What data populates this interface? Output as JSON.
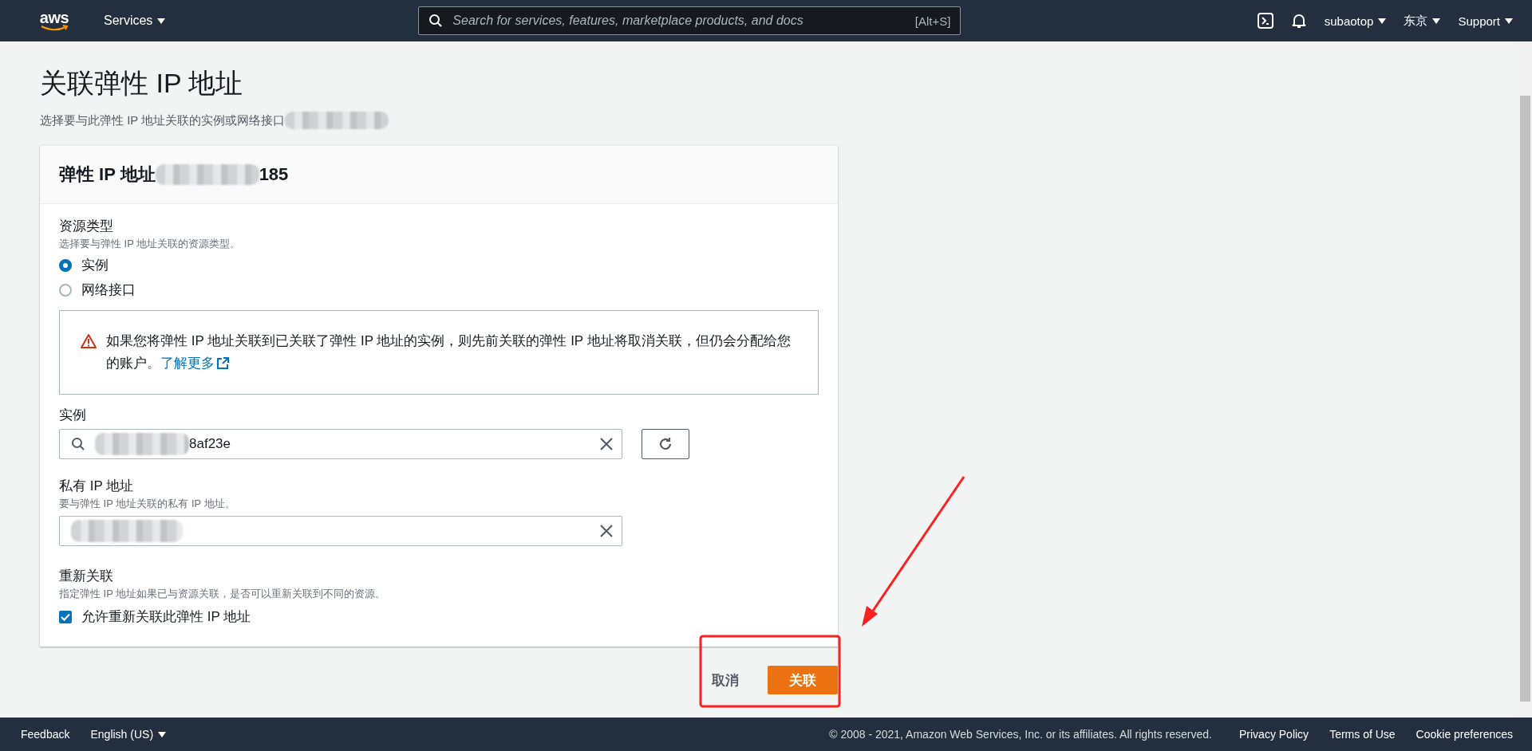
{
  "top_nav": {
    "logo": "aws",
    "services": "Services",
    "search": {
      "placeholder": "Search for services, features, marketplace products, and docs",
      "shortcut": "[Alt+S]"
    },
    "menus": [
      {
        "label": "subaotop"
      },
      {
        "label": "东京"
      },
      {
        "label": "Support"
      }
    ]
  },
  "page": {
    "title": "关联弹性 IP 地址",
    "subtitle": "选择要与此弹性 IP 地址关联的实例或网络接口"
  },
  "card": {
    "header_prefix": "弹性 IP 地址",
    "header_suffix": "185",
    "resource_type": {
      "label": "资源类型",
      "description": "选择要与弹性 IP 地址关联的资源类型。",
      "options": [
        {
          "label": "实例",
          "selected": true
        },
        {
          "label": "网络接口",
          "selected": false
        }
      ]
    },
    "warning": {
      "text": "如果您将弹性 IP 地址关联到已关联了弹性 IP 地址的实例，则先前关联的弹性 IP 地址将取消关联，但仍会分配给您的账户。",
      "link": "了解更多"
    },
    "instance": {
      "label": "实例",
      "value": "8af23e"
    },
    "private_ip": {
      "label": "私有 IP 地址",
      "description": "要与弹性 IP 地址关联的私有 IP 地址。"
    },
    "reassociation": {
      "label": "重新关联",
      "description": "指定弹性 IP 地址如果已与资源关联，是否可以重新关联到不同的资源。",
      "checkbox": {
        "label": "允许重新关联此弹性 IP 地址",
        "checked": true
      }
    }
  },
  "actions": {
    "cancel": "取消",
    "submit": "关联"
  },
  "footer": {
    "left": [
      {
        "label": "Feedback",
        "kind": "link"
      },
      {
        "label": "English (US)",
        "kind": "dropdown"
      }
    ],
    "copyright": "© 2008 - 2021, Amazon Web Services, Inc. or its affiliates. All rights reserved.",
    "links": [
      "Privacy Policy",
      "Terms of Use",
      "Cookie preferences"
    ]
  }
}
